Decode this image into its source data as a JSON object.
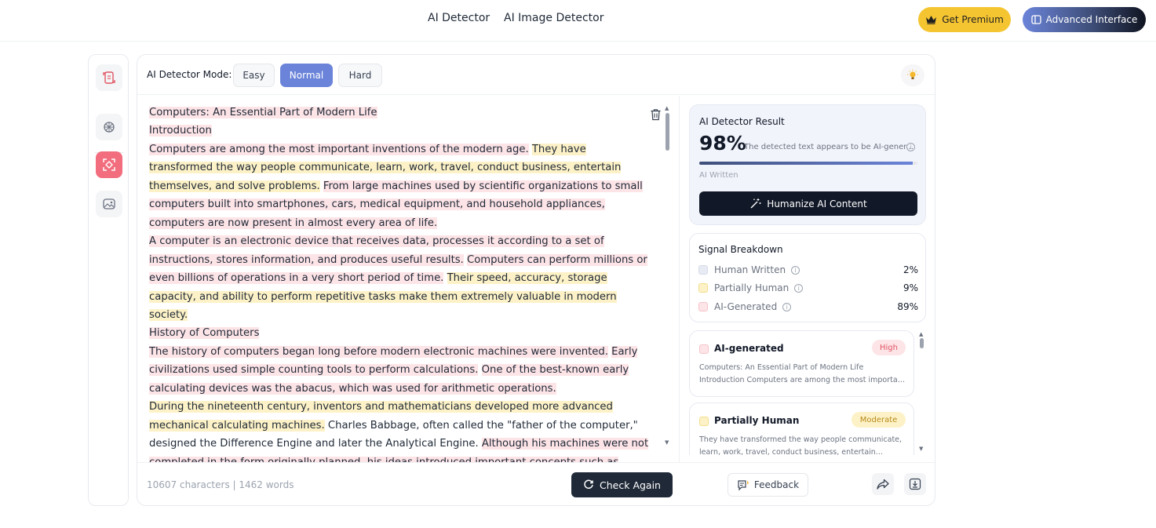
{
  "nav": {
    "links": [
      "AI Detector",
      "AI Image Detector"
    ],
    "premium_label": "Get Premium",
    "advanced_label": "Advanced Interface"
  },
  "rail": {
    "icons": [
      "document-scan-icon",
      "brain-icon",
      "ai-scan-icon",
      "image-scan-icon"
    ],
    "active_index": 2
  },
  "mode": {
    "label": "AI Detector Mode:",
    "options": [
      "Easy",
      "Normal",
      "Hard"
    ],
    "selected": "Normal"
  },
  "editor": {
    "segments": [
      {
        "text": "Computers: An Essential Part of Modern Life",
        "type": "ai",
        "br": true
      },
      {
        "text": "Introduction",
        "type": "ai",
        "br": true
      },
      {
        "text": "Computers are among the most important inventions of the modern age.",
        "type": "ai"
      },
      {
        "text": " ",
        "type": "human"
      },
      {
        "text": "They have transformed the way people communicate, learn, work, travel, conduct business, entertain themselves, and solve problems.",
        "type": "partial"
      },
      {
        "text": " ",
        "type": "human"
      },
      {
        "text": "From large machines used by scientific organizations to small computers built into smartphones, cars, medical equipment, and household appliances, computers are now present in almost every area of life.",
        "type": "ai",
        "br": true
      },
      {
        "text": "A computer is an electronic device that receives data, processes it according to a set of instructions, stores information, and produces useful results.",
        "type": "ai"
      },
      {
        "text": " ",
        "type": "human"
      },
      {
        "text": "Computers can perform millions or even billions of operations in a very short period of time.",
        "type": "ai"
      },
      {
        "text": " ",
        "type": "human"
      },
      {
        "text": "Their speed, accuracy, storage capacity, and ability to perform repetitive tasks make them extremely valuable in modern society.",
        "type": "partial",
        "br": true
      },
      {
        "text": "History of Computers",
        "type": "ai",
        "br": true
      },
      {
        "text": "The history of computers began long before modern electronic machines were invented.",
        "type": "ai"
      },
      {
        "text": " ",
        "type": "human"
      },
      {
        "text": "Early civilizations used simple counting tools to perform calculations.",
        "type": "ai"
      },
      {
        "text": " ",
        "type": "human"
      },
      {
        "text": "One of the best-known early calculating devices was the abacus, which was used for arithmetic operations.",
        "type": "ai",
        "br": true
      },
      {
        "text": "During the nineteenth century, inventors and mathematicians developed more advanced mechanical calculating machines.",
        "type": "partial"
      },
      {
        "text": " Charles Babbage, often called the \"father of the computer,\" designed the Difference Engine and later the Analytical Engine. ",
        "type": "human"
      },
      {
        "text": "Although his machines were not completed in the form originally planned, his ideas introduced important concepts such as memory",
        "type": "ai"
      }
    ]
  },
  "result": {
    "title": "AI Detector Result",
    "percent_label": "98%",
    "percent_value": 98,
    "description": "The detected text appears to be AI-gener...",
    "sub_label": "AI Written",
    "humanize_label": "Humanize AI Content"
  },
  "signals": {
    "title": "Signal Breakdown",
    "rows": [
      {
        "label": "Human Written",
        "value": "2%",
        "color": "#e8ebf3"
      },
      {
        "label": "Partially Human",
        "value": "9%",
        "color": "#fdf2c7"
      },
      {
        "label": "AI-Generated",
        "value": "89%",
        "color": "#fde4e7"
      }
    ]
  },
  "items": [
    {
      "name": "AI-generated",
      "badge": "High",
      "badge_color": "#fde4e7",
      "badge_text_color": "#e05563",
      "excerpt": [
        "Computers: An Essential Part of Modern Life",
        "Introduction Computers are among the most importan..."
      ]
    },
    {
      "name": "Partially Human",
      "badge": "Moderate",
      "badge_color": "#fdf2c7",
      "badge_text_color": "#b7891a",
      "excerpt": [
        "They have transformed the way people communicate,",
        "learn, work, travel, conduct business, entertain..."
      ]
    }
  ],
  "footer": {
    "counts": "10607 characters | 1462 words",
    "check_label": "Check Again",
    "feedback_label": "Feedback"
  },
  "colors": {
    "ai_highlight": "#fde4e7",
    "partial_highlight": "#fdf2c7",
    "accent": "#6b84d9",
    "premium": "#f5c531"
  }
}
